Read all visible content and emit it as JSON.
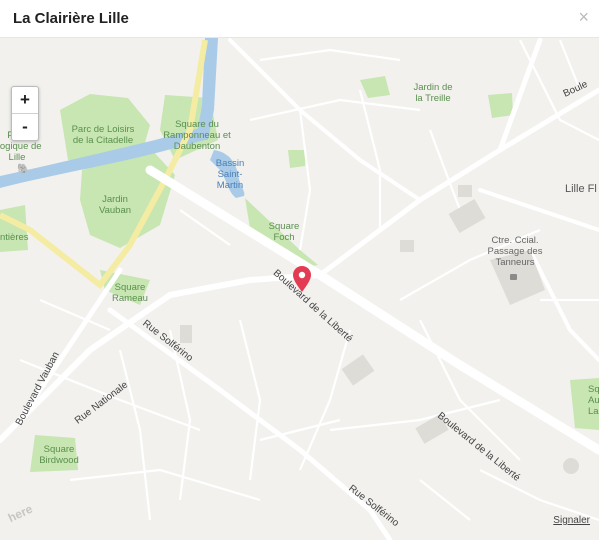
{
  "header": {
    "title": "La Clairière Lille",
    "close_label": "×"
  },
  "controls": {
    "zoom_in": "+",
    "zoom_out": "-",
    "report_label": "Signaler"
  },
  "map": {
    "labels": {
      "parc_bio": "Parc\nologique de\nLille",
      "parc_loisirs": "Parc de Loisirs\nde la Citadelle",
      "square_ramponneau": "Square du\nRamponneau et\nDaubenton",
      "bassin": "Bassin\nSaint-\nMartin",
      "jardin_treille": "Jardin de\nla Treille",
      "jardin_vauban": "Jardin\nVauban",
      "square_foch": "Square\nFoch",
      "square_rameau": "Square\nRameau",
      "square_birdwood": "Square\nBirdwood",
      "square_augustin": "Squ\nAug\nLau",
      "ntieres": "ntières",
      "ctre": "Ctre. Ccial.\nPassage des\nTanneurs",
      "lille_fl": "Lille Fl",
      "boulevard_vauban": "Boulevard Vauban",
      "rue_nationale": "Rue Nationale",
      "rue_solferino_1": "Rue Solférino",
      "rue_solferino_2": "Rue Solférino",
      "boulevard_liberte_1": "Boulevard de la Liberté",
      "boulevard_liberte_2": "Boulevard de la Liberté",
      "boulevard_top": "Boule",
      "watermark": "here"
    },
    "colors": {
      "background": "#f2f1ee",
      "park": "#c7e6b1",
      "water": "#a9cbe8",
      "marker": "#e33b53",
      "highway": "#f5eca4"
    }
  }
}
